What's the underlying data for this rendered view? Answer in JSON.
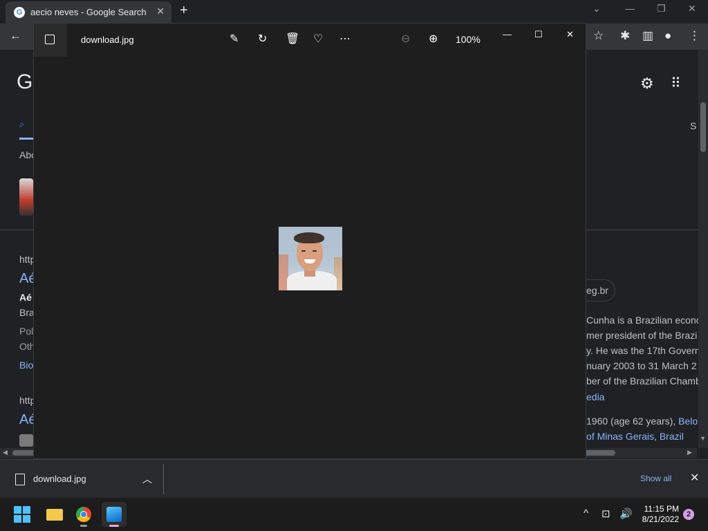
{
  "browser": {
    "tab_title": "aecio neves - Google Search",
    "tab_favicon": "G",
    "icons": [
      "google-favicon-icon",
      "close-icon",
      "plus-icon",
      "chevron-down-icon",
      "minimize-icon",
      "restore-icon",
      "close-icon",
      "back-arrow-icon",
      "star-icon",
      "puzzle-icon",
      "sidebar-icon",
      "profile-icon",
      "kebab-icon"
    ]
  },
  "page": {
    "logo_letter": "G",
    "search_tab_fragment": "S",
    "about_fragment": "Abo",
    "result1": {
      "url_fragment": "http",
      "title_fragment": "Aé",
      "bold_fragment": "Aé",
      "line2_fragment": "Bra",
      "line3_fragment": "Pol",
      "line4_fragment": "Oth",
      "link_fragment": "Bio"
    },
    "result2": {
      "url_fragment": "http",
      "title_fragment": "Aé"
    },
    "right_panel": {
      "chip_fragment": "eg.br",
      "lines": [
        "Cunha is a Brazilian econo",
        "mer president of the Brazi",
        "y. He was the 17th Govern",
        "nuary 2003 to 31 March 2",
        "ber of the Brazilian Chamb"
      ],
      "wiki_fragment": "edia",
      "born_text": " 1960 (age 62 years), ",
      "born_link1": "Belo",
      "born_line2_link1": "of Minas Gerais",
      "born_line2_sep": ", ",
      "born_line2_link2": "Brazil"
    },
    "colors": {
      "background": "#202124",
      "link": "#8ab4f8",
      "text": "#bdc1c6"
    }
  },
  "viewer": {
    "file_name": "download.jpg",
    "zoom_level": "100%",
    "toolbar_icons": [
      "edit-image-icon",
      "rotate-icon",
      "delete-icon",
      "favorite-heart-icon",
      "more-options-icon",
      "zoom-out-icon",
      "zoom-in-icon"
    ],
    "window_controls": [
      "minimize-icon",
      "maximize-icon",
      "close-icon"
    ],
    "image_description_name": "portrait-photo"
  },
  "downloads": {
    "file_name": "download.jpg",
    "show_all_label": "Show all"
  },
  "taskbar": {
    "time": "11:15 PM",
    "date": "8/21/2022",
    "notification_count": "2",
    "accent": "#4cc2ff"
  }
}
